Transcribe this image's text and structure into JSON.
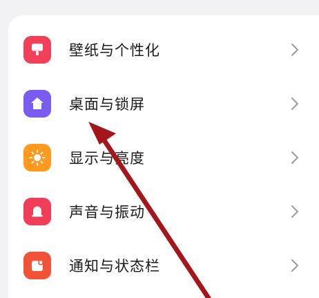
{
  "settings": {
    "items": [
      {
        "label": "壁纸与个性化",
        "icon": "wallpaper-icon",
        "color": "#f0405a"
      },
      {
        "label": "桌面与锁屏",
        "icon": "home-icon",
        "color": "#7b5cf0"
      },
      {
        "label": "显示与亮度",
        "icon": "sun-icon",
        "color": "#ff9a1f"
      },
      {
        "label": "声音与振动",
        "icon": "bell-icon",
        "color": "#f23d5a"
      },
      {
        "label": "通知与状态栏",
        "icon": "notification-icon",
        "color": "#f25238"
      }
    ]
  },
  "annotation": {
    "arrow_color": "#a3161a"
  }
}
